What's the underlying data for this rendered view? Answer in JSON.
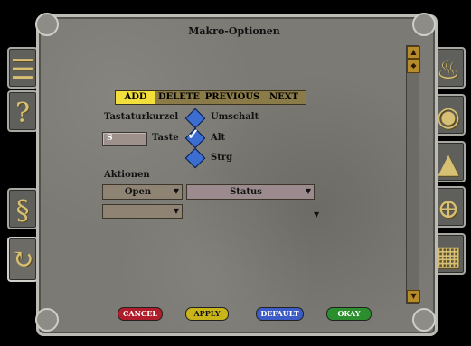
{
  "window": {
    "title": "Makro-Optionen"
  },
  "toolbar": {
    "add": "ADD",
    "delete": "DELETE",
    "previous": "PREVIOUS",
    "next": "NEXT"
  },
  "hotkey": {
    "heading": "Tastaturkurzel",
    "key_value": "S",
    "key_label": "Taste",
    "modifiers": [
      {
        "label": "Umschalt",
        "checked": false
      },
      {
        "label": "Alt",
        "checked": true
      },
      {
        "label": "Strg",
        "checked": false
      }
    ]
  },
  "actions": {
    "heading": "Aktionen",
    "action_select": "Open",
    "param_select": "Status",
    "empty_select": ""
  },
  "footer": {
    "cancel": "CANCEL",
    "apply": "APPLY",
    "default": "DEFAULT",
    "okay": "OKAY"
  },
  "colors": {
    "cancel": "#b01d2a",
    "apply": "#c9b51a",
    "default": "#3c5bc7",
    "okay": "#2c8f2e",
    "toolbar_active": "#f2df3b"
  },
  "side_tabs_left_icons": [
    "map-icon",
    "help-icon",
    "skill-icon",
    "refresh-icon"
  ],
  "side_tabs_right_icons": [
    "drink-icon",
    "eye-icon",
    "pyramid-icon",
    "target-icon",
    "grid-icon"
  ]
}
